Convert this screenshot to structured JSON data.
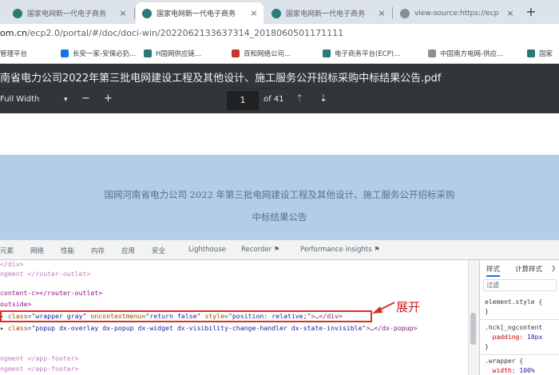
{
  "browser": {
    "tabs": [
      {
        "label": "国家电网新一代电子商务",
        "close": "×"
      },
      {
        "label": "国家电网新一代电子商务",
        "close": "×"
      },
      {
        "label": "国家电网新一代电子商务",
        "close": "×"
      },
      {
        "label": "view-source:https://ecp",
        "close": "×"
      }
    ],
    "new_tab": "+",
    "url_host": "om.cn",
    "url_path": "/ecp2.0/portal/#/doc/doci-win/2022062133637314_2018060501171111"
  },
  "bookmarks": [
    {
      "label": "管理平台",
      "color": "#2b7a78"
    },
    {
      "label": "长安一家-安保必扔...",
      "color": "#1a73e8"
    },
    {
      "label": "H国网供应链...",
      "color": "#2b7a78"
    },
    {
      "label": "百和网络公司...",
      "color": "#c0392b"
    },
    {
      "label": "电子商务平台(ECP)...",
      "color": "#2b7a78"
    },
    {
      "label": "中国南方电网-供应...",
      "color": "#8a8f96"
    },
    {
      "label": "国家",
      "color": "#2b7a78"
    }
  ],
  "pdf": {
    "title": "南省电力公司2022年第三批电网建设工程及其他设计、施工服务公开招标采购中标结果公告.pdf",
    "fit_label": "Full Width",
    "zoom_out": "−",
    "zoom_in": "+",
    "page_number": "1",
    "page_total": "of 41",
    "doc_heading_line1": "国网河南省电力公司 2022 年第三批电网建设工程及其他设计、施工服务公开招标采购",
    "doc_heading_line2": "中标结果公告"
  },
  "devtools": {
    "tabs": [
      "元素",
      "网络",
      "性能",
      "内存",
      "应用",
      "安全",
      "Lighthouse",
      "Recorder ⚑",
      "Performance insights ⚑"
    ],
    "code_lines": [
      {
        "kind": "faint",
        "text": "</div>"
      },
      {
        "kind": "faint",
        "text": "ngment </router-outlet>"
      },
      {
        "kind": "blank",
        "text": ""
      },
      {
        "kind": "plain",
        "text": "content-c></router-outlet>"
      },
      {
        "kind": "plain",
        "text": "outside>"
      },
      {
        "kind": "attr",
        "tag": "div",
        "attr1": "class",
        "val1": "wrapper gray",
        "attr2": "oncontextmenu",
        "val2": "return false",
        "attr3": "style",
        "val3": "position: relative;",
        "tail": ">…</div>"
      },
      {
        "kind": "attr",
        "tag": "div",
        "attr1": "class",
        "val1": "popup dx-overlay dx-popup dx-widget dx-visibility-change-handler dx-state-invisible",
        "attr2": "",
        "val2": "",
        "attr3": "",
        "val3": "",
        "tail": ">…</dx-popup>"
      },
      {
        "kind": "blank",
        "text": ""
      },
      {
        "kind": "faint",
        "text": "ngment </app-footer>"
      },
      {
        "kind": "faint",
        "text": "ngment </app-footer>"
      }
    ],
    "annotation": "展开",
    "styles_tabs": [
      "样式",
      "计算样式",
      "》"
    ],
    "filter_placeholder": "过滤",
    "style_rules": [
      {
        "selector": "element.style {",
        "prop": "",
        "value": ""
      },
      {
        "selector": "}",
        "prop": "",
        "value": ""
      },
      {
        "selector": ".hck[_ngcontent",
        "prop": "",
        "value": ""
      },
      {
        "selector": "",
        "prop": "padding",
        "value": "10px"
      },
      {
        "selector": "}",
        "prop": "",
        "value": ""
      },
      {
        "selector": ".wrapper {",
        "prop": "",
        "value": ""
      },
      {
        "selector": "",
        "prop": "width",
        "value": "100%"
      }
    ]
  }
}
